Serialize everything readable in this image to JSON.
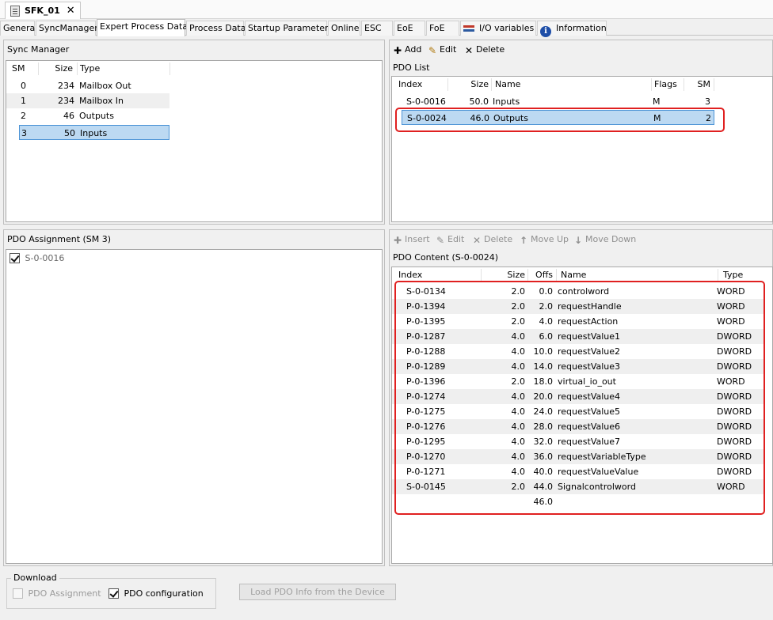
{
  "document_tab": {
    "title": "SFK_01",
    "close": "✕"
  },
  "tabs": [
    "General",
    "SyncManager",
    "Expert Process Data",
    "Process Data",
    "Startup Parameters",
    "Online",
    "ESC",
    "EoE",
    "FoE",
    "I/O variables",
    "Information"
  ],
  "active_tab": "Expert Process Data",
  "sync_manager": {
    "title": "Sync Manager",
    "columns": [
      "SM",
      "Size",
      "Type"
    ],
    "rows": [
      [
        "0",
        "234",
        "Mailbox Out"
      ],
      [
        "1",
        "234",
        "Mailbox In"
      ],
      [
        "2",
        "46",
        "Outputs"
      ],
      [
        "3",
        "50",
        "Inputs"
      ]
    ],
    "selected_row": 3
  },
  "pdo_toolbar": {
    "add": "Add",
    "edit": "Edit",
    "delete": "Delete"
  },
  "pdo_list": {
    "title": "PDO List",
    "columns": [
      "Index",
      "Size",
      "Name",
      "Flags",
      "SM"
    ],
    "rows": [
      [
        "S-0-0016",
        "50.0",
        "Inputs",
        "M",
        "3"
      ],
      [
        "S-0-0024",
        "46.0",
        "Outputs",
        "M",
        "2"
      ]
    ],
    "selected_row": 1
  },
  "pdo_assignment": {
    "title": "PDO Assignment (SM 3)",
    "items": [
      {
        "label": "S-0-0016",
        "checked": true
      }
    ]
  },
  "content_toolbar": {
    "insert": "Insert",
    "edit": "Edit",
    "delete": "Delete",
    "move_up": "Move Up",
    "move_down": "Move Down"
  },
  "pdo_content": {
    "title": "PDO Content (S-0-0024)",
    "columns": [
      "Index",
      "Size",
      "Offs",
      "Name",
      "Type"
    ],
    "rows": [
      [
        "S-0-0134",
        "2.0",
        "0.0",
        "controlword",
        "WORD"
      ],
      [
        "P-0-1394",
        "2.0",
        "2.0",
        "requestHandle",
        "WORD"
      ],
      [
        "P-0-1395",
        "2.0",
        "4.0",
        "requestAction",
        "WORD"
      ],
      [
        "P-0-1287",
        "4.0",
        "6.0",
        "requestValue1",
        "DWORD"
      ],
      [
        "P-0-1288",
        "4.0",
        "10.0",
        "requestValue2",
        "DWORD"
      ],
      [
        "P-0-1289",
        "4.0",
        "14.0",
        "requestValue3",
        "DWORD"
      ],
      [
        "P-0-1396",
        "2.0",
        "18.0",
        "virtual_io_out",
        "WORD"
      ],
      [
        "P-0-1274",
        "4.0",
        "20.0",
        "requestValue4",
        "DWORD"
      ],
      [
        "P-0-1275",
        "4.0",
        "24.0",
        "requestValue5",
        "DWORD"
      ],
      [
        "P-0-1276",
        "4.0",
        "28.0",
        "requestValue6",
        "DWORD"
      ],
      [
        "P-0-1295",
        "4.0",
        "32.0",
        "requestValue7",
        "DWORD"
      ],
      [
        "P-0-1270",
        "4.0",
        "36.0",
        "requestVariableType",
        "DWORD"
      ],
      [
        "P-0-1271",
        "4.0",
        "40.0",
        "requestValueValue",
        "DWORD"
      ],
      [
        "S-0-0145",
        "2.0",
        "44.0",
        "Signalcontrolword",
        "WORD"
      ],
      [
        "",
        "",
        "46.0",
        "",
        ""
      ]
    ]
  },
  "download": {
    "title": "Download",
    "pdo_assignment": {
      "label": "PDO Assignment",
      "checked": false,
      "disabled": true
    },
    "pdo_configuration": {
      "label": "PDO configuration",
      "checked": true,
      "disabled": false
    }
  },
  "load_button": "Load PDO Info from the Device",
  "colors": {
    "selection": "#bcd9f2",
    "highlight_box": "#e02020"
  }
}
